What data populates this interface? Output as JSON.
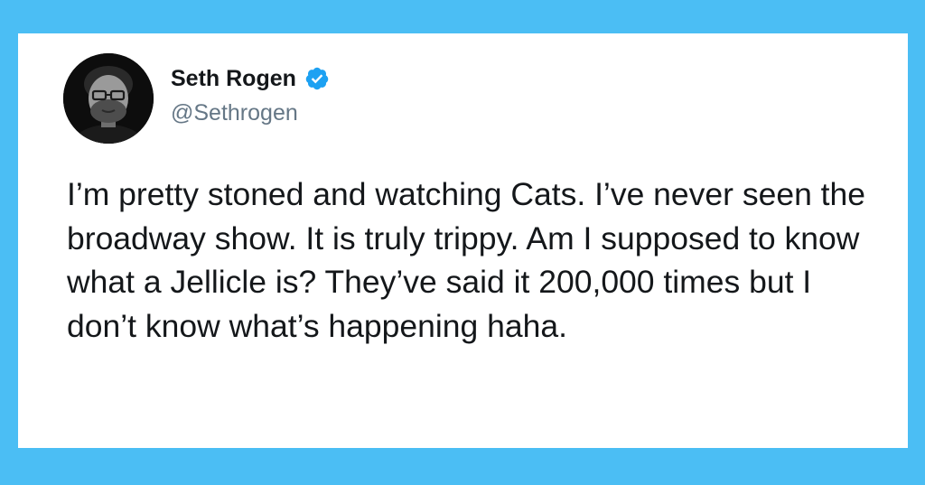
{
  "tweet": {
    "author": {
      "name": "Seth Rogen",
      "handle": "@Sethrogen",
      "verified": true,
      "verified_icon": "verified-badge-icon",
      "avatar": "profile-photo"
    },
    "text": "I’m pretty stoned and watching Cats. I’ve never seen the broadway show. It is truly trippy. Am I supposed to know what a Jellicle is? They’ve said it 200,000 times but I don’t know what’s happening haha."
  },
  "colors": {
    "background": "#4bbef4",
    "card": "#ffffff",
    "text_primary": "#14171a",
    "text_secondary": "#657786",
    "verified": "#1da1f2"
  }
}
